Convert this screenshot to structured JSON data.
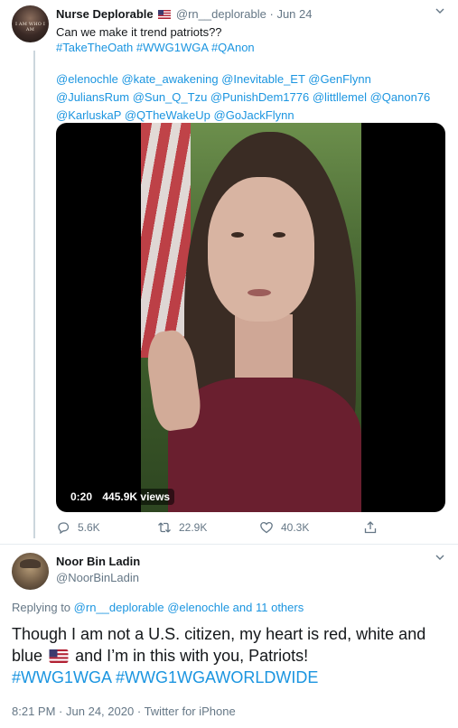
{
  "tweet": {
    "author_name": "Nurse Deplorable",
    "author_flag_icon": "us-flag-icon",
    "handle": "@rn__deplorable",
    "separator": "·",
    "date": "Jun 24",
    "avatar_text": "I AM WHO I AM",
    "text_line1": "Can we make it trend patriots??",
    "hashtags": "#TakeTheOath #WWG1WGA #QAnon",
    "mentions_line1": "@elenochle @kate_awakening @Inevitable_ET @GenFlynn",
    "mentions_line2": "@JuliansRum @Sun_Q_Tzu @PunishDem1776 @littllemel @Qanon76",
    "mentions_line3": "@KarluskaP @QTheWakeUp @GoJackFlynn",
    "video": {
      "time": "0:20",
      "views": "445.9K views"
    },
    "actions": {
      "replies": "5.6K",
      "retweets": "22.9K",
      "likes": "40.3K"
    }
  },
  "reply": {
    "author_name": "Noor Bin Ladin",
    "handle": "@NoorBinLadin",
    "replying_prefix": "Replying to",
    "replying_handles": "@rn__deplorable @elenochle and 11 others",
    "text_part1": "Though I am not a U.S. citizen, my heart is red, white and blue",
    "text_part2": "and I’m in this with you, Patriots!",
    "hashtags": "#WWG1WGA #WWG1WGAWORLDWIDE",
    "time": "8:21 PM",
    "date": "Jun 24, 2020",
    "separator": "·",
    "source": "Twitter for iPhone"
  },
  "colors": {
    "accent": "#1b95e0",
    "muted": "#657786",
    "text": "#14171a"
  }
}
